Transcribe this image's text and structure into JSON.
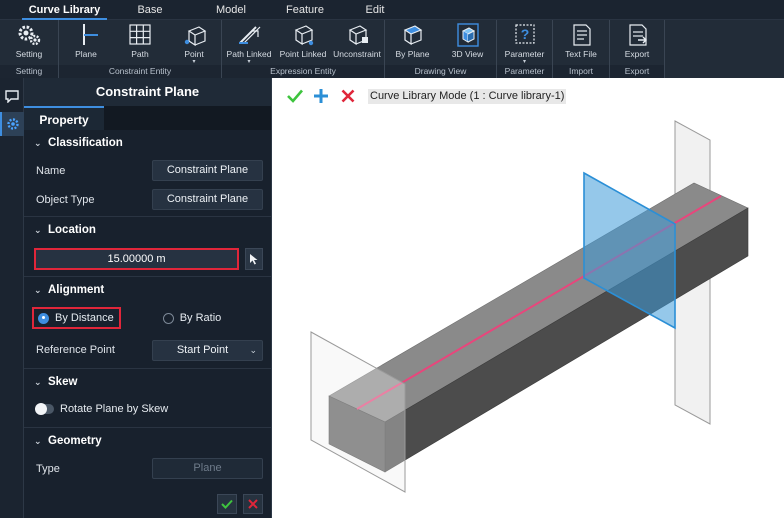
{
  "menubar": {
    "tabs": [
      "Curve Library",
      "Base",
      "Model",
      "Feature",
      "Edit"
    ]
  },
  "ribbon": {
    "groups": [
      {
        "label": "Setting",
        "buttons": [
          {
            "label": "Setting",
            "icon": "gears-icon"
          }
        ]
      },
      {
        "label": "Constraint Entity",
        "buttons": [
          {
            "label": "Plane",
            "icon": "plane-icon"
          },
          {
            "label": "Path",
            "icon": "path-grid-icon"
          },
          {
            "label": "Point",
            "icon": "point-icon",
            "dropdown": "▾"
          }
        ]
      },
      {
        "label": "Expression Entity",
        "buttons": [
          {
            "label": "Path Linked",
            "icon": "path-linked-icon",
            "dropdown": "▾"
          },
          {
            "label": "Point Linked",
            "icon": "point-linked-icon"
          },
          {
            "label": "Unconstraint",
            "icon": "unconstraint-icon"
          }
        ]
      },
      {
        "label": "Drawing View",
        "buttons": [
          {
            "label": "By Plane",
            "icon": "by-plane-icon"
          },
          {
            "label": "3D View",
            "icon": "cube-3d-icon"
          }
        ]
      },
      {
        "label": "Parameter",
        "buttons": [
          {
            "label": "Parameter",
            "icon": "parameter-icon",
            "dropdown": "▾"
          }
        ]
      },
      {
        "label": "Import",
        "buttons": [
          {
            "label": "Text File",
            "icon": "text-file-icon"
          }
        ]
      },
      {
        "label": "Export",
        "buttons": [
          {
            "label": "Export",
            "icon": "export-icon"
          }
        ]
      }
    ]
  },
  "panel": {
    "title": "Constraint Plane",
    "tab": "Property",
    "classification": {
      "title": "Classification",
      "name_label": "Name",
      "name_value": "Constraint Plane",
      "type_label": "Object Type",
      "type_value": "Constraint Plane"
    },
    "location": {
      "title": "Location",
      "value": "15.00000 m"
    },
    "alignment": {
      "title": "Alignment",
      "by_distance": "By Distance",
      "by_ratio": "By Ratio",
      "ref_label": "Reference Point",
      "ref_value": "Start Point"
    },
    "skew": {
      "title": "Skew",
      "toggle_label": "Rotate Plane by Skew"
    },
    "geometry": {
      "title": "Geometry",
      "type_label": "Type",
      "type_value": "Plane"
    }
  },
  "viewport": {
    "mode_label": "Curve Library Mode (1 : Curve library-1)"
  },
  "colors": {
    "accent": "#3e8ee0",
    "highlight": "#e0263a",
    "confirm": "#3ec43e",
    "cancel": "#e0263a"
  }
}
